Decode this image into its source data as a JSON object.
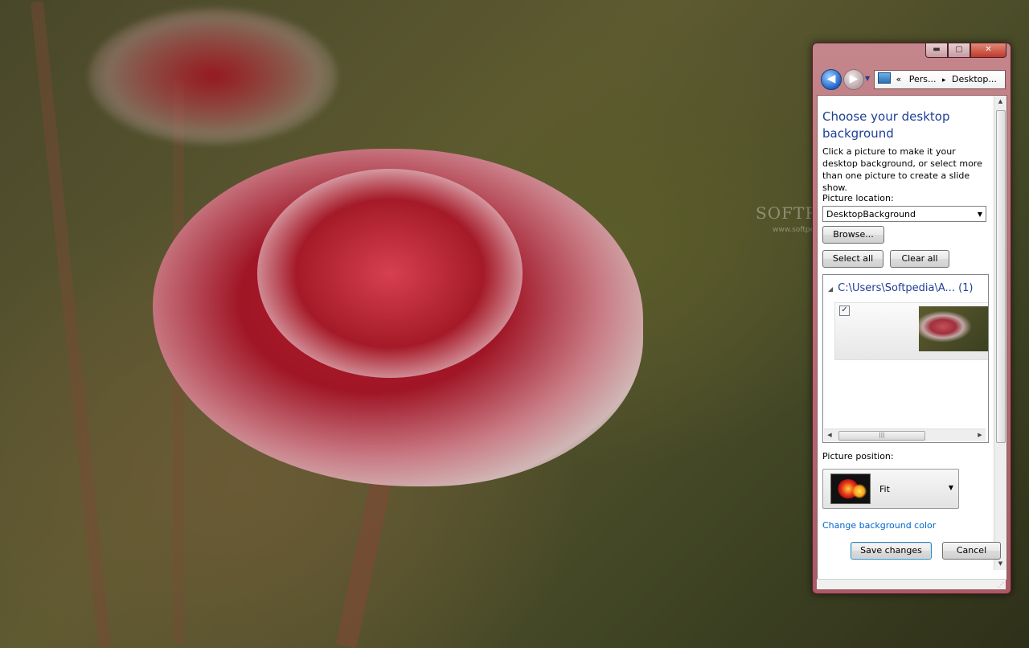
{
  "window": {
    "controls": {
      "minimize": "▬",
      "maximize": "▢",
      "close": "✕"
    },
    "breadcrumb": {
      "prefix": "«",
      "part1": "Pers...",
      "sep": "▸",
      "part2": "Desktop..."
    }
  },
  "panel": {
    "heading": "Choose your desktop background",
    "description": "Click a picture to make it your desktop background, or select more than one picture to create a slide show.",
    "picture_location_label": "Picture location:",
    "picture_location_value": "DesktopBackground",
    "browse_label": "Browse...",
    "select_all_label": "Select all",
    "clear_all_label": "Clear all",
    "group_title": "C:\\Users\\Softpedia\\A... (1)",
    "thumbnail_checked": "✓",
    "hscroll_grip": "|||",
    "picture_position_label": "Picture position:",
    "picture_position_value": "Fit",
    "change_color_link": "Change background color",
    "save_label": "Save changes",
    "cancel_label": "Cancel"
  },
  "desktop": {
    "watermark": "SOFTPEDIA",
    "watermark_url": "www.softpedia.com"
  },
  "colors": {
    "accent_heading": "#1e3f96",
    "link": "#0066cc",
    "frame": "#b56a73"
  }
}
